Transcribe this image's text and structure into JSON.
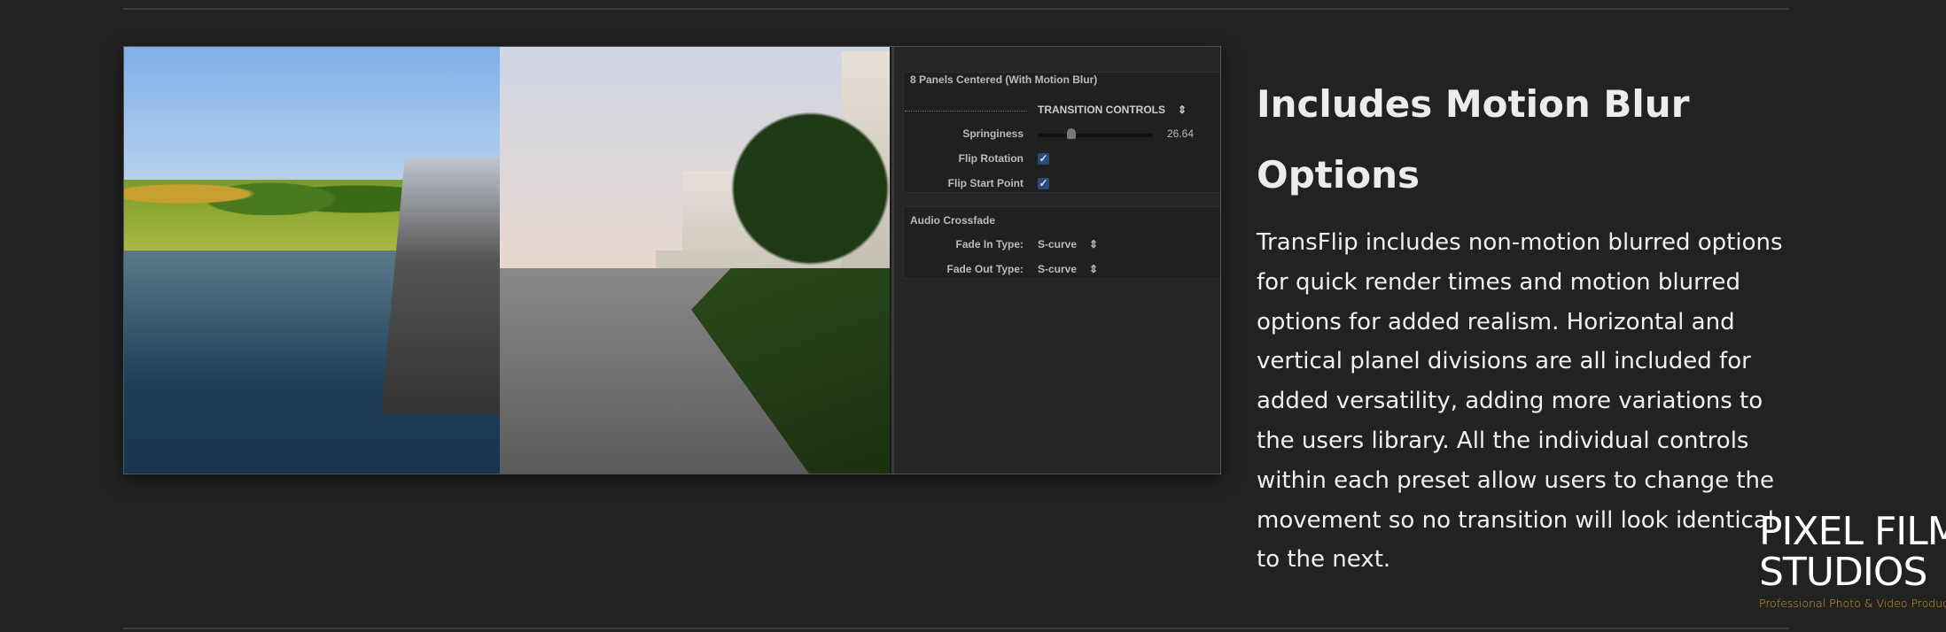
{
  "panel": {
    "preset_title": "8 Panels Centered (With Motion Blur)",
    "section_dropdown": "TRANSITION CONTROLS",
    "springiness_label": "Springiness",
    "springiness_value": "26.64",
    "springiness_fraction": 0.3,
    "flip_rotation_label": "Flip Rotation",
    "flip_rotation_checked": true,
    "flip_start_label": "Flip Start Point",
    "flip_start_checked": true,
    "audio_title": "Audio Crossfade",
    "fade_in_label": "Fade In Type:",
    "fade_in_value": "S-curve",
    "fade_out_label": "Fade Out Type:",
    "fade_out_value": "S-curve",
    "check_glyph": "✓",
    "stepper_glyph": "⇕"
  },
  "article": {
    "heading": "Includes Motion Blur Options",
    "body": "TransFlip includes non-motion blurred options for quick render times and motion blurred options for added realism. Horizontal and vertical planel divisions are all included for added versatility, adding more variations to the users library. All the individual controls within each preset allow users to change the movement so no transition will look identical to the next."
  },
  "logo": {
    "line1": "PIXEL FILM",
    "line2": "STUDIOS",
    "tagline": "Professional Photo & Video Production",
    "tagline_color": "#d4a020"
  }
}
